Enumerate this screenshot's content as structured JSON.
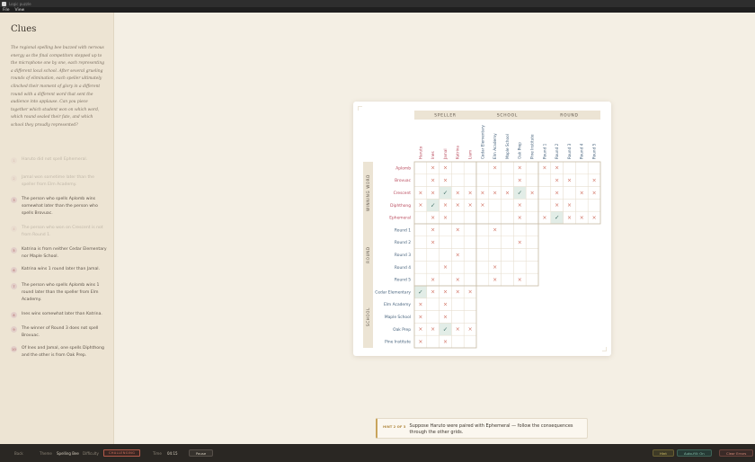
{
  "window": {
    "title": "Logic puzzle"
  },
  "menu": [
    {
      "label": "File"
    },
    {
      "label": "View"
    }
  ],
  "sidebar": {
    "title": "Clues",
    "story": "The regional spelling bee buzzed with nervous energy as the final competitors stepped up to the microphone one by one, each representing a different local school. After several grueling rounds of elimination, each speller ultimately clinched their moment of glory in a different round with a different word that sent the audience into applause. Can you piece together which student won on which word, which round sealed their fate, and which school they proudly represented?"
  },
  "clues": [
    {
      "num": "1",
      "text": "Haruto did not spell Ephemeral.",
      "done": true
    },
    {
      "num": "2",
      "text": "Jamal won sometime later than the speller from Elm Academy.",
      "done": true
    },
    {
      "num": "3",
      "text": "The person who spells Aplomb wins somewhat later than the person who spells Brovuac.",
      "done": false
    },
    {
      "num": "4",
      "text": "The person who won on Crescent is not from Round 1.",
      "done": true
    },
    {
      "num": "5",
      "text": "Katrina is from neither Cedar Elementary nor Maple School.",
      "done": false
    },
    {
      "num": "6",
      "text": "Katrina wins 1 round later than Jamal.",
      "done": false
    },
    {
      "num": "7",
      "text": "The person who spells Aplomb wins 1 round later than the speller from Elm Academy.",
      "done": false
    },
    {
      "num": "8",
      "text": "Ines wins somewhat later than Katrina.",
      "done": false
    },
    {
      "num": "9",
      "text": "The winner of Round 3 does not spell Brovuac.",
      "done": false
    },
    {
      "num": "10",
      "text": "Of Ines and Jamal, one spells Diphthong and the other is from Oak Prep.",
      "done": false
    }
  ],
  "grid": {
    "col_groups": [
      {
        "label": "SPELLER",
        "items": [
          "Haruto",
          "Ines",
          "Jamal",
          "Katrina",
          "Liam"
        ]
      },
      {
        "label": "SCHOOL",
        "items": [
          "Cedar Elementary",
          "Elm Academy",
          "Maple School",
          "Oak Prep",
          "Pine Institute"
        ]
      },
      {
        "label": "ROUND",
        "items": [
          "Round 1",
          "Round 2",
          "Round 3",
          "Round 4",
          "Round 5"
        ]
      }
    ],
    "row_groups": [
      {
        "label": "WINNING WORD",
        "items": [
          "Aplomb",
          "Brovuac",
          "Crescent",
          "Diphthong",
          "Ephemeral"
        ]
      },
      {
        "label": "ROUND",
        "items": [
          "Round 1",
          "Round 2",
          "Round 3",
          "Round 4",
          "Round 5"
        ]
      },
      {
        "label": "SCHOOL",
        "items": [
          "Cedar Elementary",
          "Elm Academy",
          "Maple School",
          "Oak Prep",
          "Pine Institute"
        ]
      }
    ],
    "cells": [
      [
        "   x x ",
        "   x x x ",
        "x x x x",
        "x x",
        "  x  x"
      ],
      [
        " x x   ",
        "    x    ",
        "x     x",
        "x  x",
        "  x x"
      ],
      [
        "x x o x x",
        "x x x o x",
        "  x x x",
        "x x",
        " x  x"
      ],
      [
        "x o x x x",
        "x   x    ",
        "x x x  ",
        "x x",
        "x  x "
      ],
      [
        "  x x  ",
        "      x ",
        "x o x x x",
        "",
        "x"
      ]
    ],
    "blocks": [
      [
        [
          [
            0,
            0,
            1
          ],
          [
            0,
            1,
            1
          ],
          [
            0,
            2,
            0
          ],
          [
            0,
            3,
            0
          ],
          [
            0,
            4,
            0
          ]
        ],
        [
          [
            1,
            0,
            0
          ],
          [
            1,
            1,
            1
          ],
          [
            1,
            2,
            1
          ],
          [
            1,
            3,
            0
          ],
          [
            1,
            4,
            0
          ]
        ],
        [
          [
            2,
            0,
            1
          ],
          [
            2,
            1,
            1
          ],
          [
            2,
            2,
            2
          ],
          [
            2,
            3,
            1
          ],
          [
            2,
            4,
            1
          ]
        ],
        [
          [
            3,
            0,
            1
          ],
          [
            3,
            1,
            2
          ],
          [
            3,
            2,
            1
          ],
          [
            3,
            3,
            1
          ],
          [
            3,
            4,
            1
          ]
        ],
        [
          [
            4,
            0,
            0
          ],
          [
            4,
            1,
            1
          ],
          [
            4,
            2,
            1
          ],
          [
            4,
            3,
            0
          ],
          [
            4,
            4,
            0
          ]
        ]
      ]
    ],
    "marks": {
      "word_speller": [
        [
          0,
          1,
          1,
          0,
          0
        ],
        [
          0,
          1,
          1,
          0,
          0
        ],
        [
          1,
          1,
          2,
          1,
          1
        ],
        [
          1,
          2,
          1,
          1,
          1
        ],
        [
          0,
          1,
          1,
          0,
          0
        ]
      ],
      "word_school": [
        [
          0,
          1,
          0,
          1,
          0
        ],
        [
          0,
          0,
          0,
          1,
          0
        ],
        [
          1,
          1,
          1,
          2,
          1
        ],
        [
          1,
          0,
          0,
          1,
          0
        ],
        [
          0,
          0,
          0,
          1,
          0
        ]
      ],
      "word_round": [
        [
          1,
          1,
          0,
          0,
          0
        ],
        [
          0,
          1,
          1,
          0,
          1
        ],
        [
          0,
          1,
          0,
          1,
          1
        ],
        [
          0,
          1,
          1,
          0,
          0
        ],
        [
          1,
          2,
          1,
          1,
          1
        ]
      ],
      "round_speller": [
        [
          0,
          1,
          0,
          1,
          0
        ],
        [
          0,
          1,
          0,
          0,
          0
        ],
        [
          0,
          0,
          0,
          1,
          0
        ],
        [
          0,
          0,
          1,
          0,
          0
        ],
        [
          0,
          1,
          0,
          1,
          0
        ]
      ],
      "round_school": [
        [
          0,
          1,
          0,
          0,
          0
        ],
        [
          0,
          0,
          0,
          1,
          0
        ],
        [
          0,
          0,
          0,
          0,
          0
        ],
        [
          0,
          1,
          0,
          0,
          0
        ],
        [
          0,
          1,
          0,
          1,
          0
        ]
      ],
      "school_speller": [
        [
          2,
          1,
          1,
          1,
          1
        ],
        [
          1,
          0,
          1,
          0,
          0
        ],
        [
          1,
          0,
          1,
          0,
          0
        ],
        [
          1,
          1,
          2,
          1,
          1
        ],
        [
          1,
          0,
          1,
          0,
          0
        ]
      ]
    }
  },
  "hint": {
    "label": "HINT 2 OF 3",
    "text": "Suppose Haruto were paired with Ephemeral — follow the consequences through the other grids."
  },
  "bottombar": {
    "back": "Back",
    "theme_label": "Theme",
    "theme_value": "Spelling Bee",
    "difficulty_label": "Difficulty",
    "difficulty_value": "CHALLENGING",
    "time_label": "Time",
    "time_value": "04:15",
    "pause": "Pause",
    "hint": "Hint",
    "autofill": "Auto-fill: On",
    "clear": "Clear Errors"
  },
  "colors": {
    "x_mark": "#d07060",
    "check_mark": "#3f6f66",
    "check_bg": "#e2ede7",
    "row_label": "#b8475a",
    "row_label_round": "#46627c",
    "header_bg": "#ece4d4",
    "grid_line": "#e7dfd0",
    "block_border": "#c8bda8"
  }
}
